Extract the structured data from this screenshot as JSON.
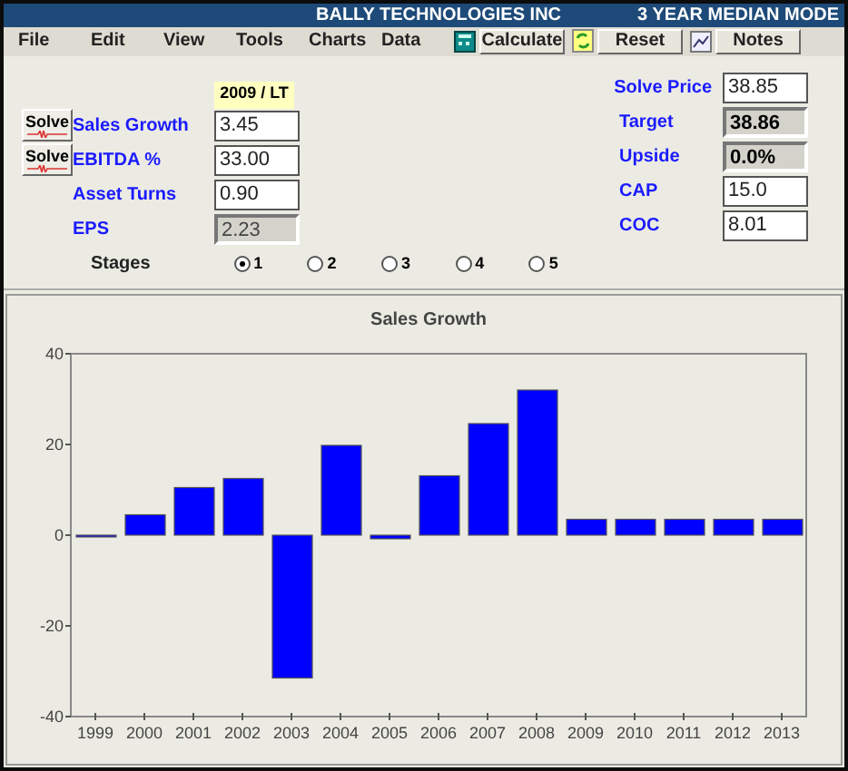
{
  "title_bar": {
    "title": "BALLY TECHNOLOGIES INC",
    "mode": "3 YEAR MEDIAN MODE"
  },
  "menu": [
    "File",
    "Edit",
    "View",
    "Tools",
    "Charts",
    "Data"
  ],
  "toolbar": [
    {
      "kind": "calculator",
      "label": "Calculate"
    },
    {
      "kind": "refresh",
      "label": "Reset"
    },
    {
      "kind": "notes",
      "label": "Notes"
    }
  ],
  "form": {
    "column_header": "2009 / LT",
    "left_fields": [
      {
        "label": "Sales Growth",
        "value": "3.45",
        "readonly": false,
        "solve": "Solve"
      },
      {
        "label": "EBITDA %",
        "value": "33.00",
        "readonly": false,
        "solve": "Solve"
      },
      {
        "label": "Asset Turns",
        "value": "0.90",
        "readonly": false
      },
      {
        "label": "EPS",
        "value": "2.23",
        "readonly": true
      }
    ],
    "right_fields": [
      {
        "label": "Solve Price",
        "value": "38.85",
        "readonly": false
      },
      {
        "label": "Target",
        "value": "38.86",
        "readonly": true
      },
      {
        "label": "Upside",
        "value": "0.0%",
        "readonly": true
      },
      {
        "label": "CAP",
        "value": "15.0",
        "readonly": false
      },
      {
        "label": "COC",
        "value": "8.01",
        "readonly": false
      }
    ],
    "stages": {
      "label": "Stages",
      "options": [
        {
          "label": "1",
          "selected": true
        },
        {
          "label": "2",
          "selected": false
        },
        {
          "label": "3",
          "selected": false
        },
        {
          "label": "4",
          "selected": false
        },
        {
          "label": "5",
          "selected": false
        }
      ]
    }
  },
  "chart_data": {
    "type": "bar",
    "title": "Sales Growth",
    "categories": [
      "1999",
      "2000",
      "2001",
      "2002",
      "2003",
      "2004",
      "2005",
      "2006",
      "2007",
      "2008",
      "2009",
      "2010",
      "2011",
      "2012",
      "2013"
    ],
    "series": [
      {
        "color": "#0000ff",
        "values": [
          0,
          4.5,
          10.5,
          12.5,
          -31.5,
          19.8,
          -0.8,
          13.1,
          24.6,
          32,
          3.5,
          3.5,
          3.5,
          3.5,
          3.5
        ]
      }
    ],
    "ylim": [
      -40,
      40
    ],
    "yticks": [
      -40,
      -20,
      0,
      20,
      40
    ]
  }
}
